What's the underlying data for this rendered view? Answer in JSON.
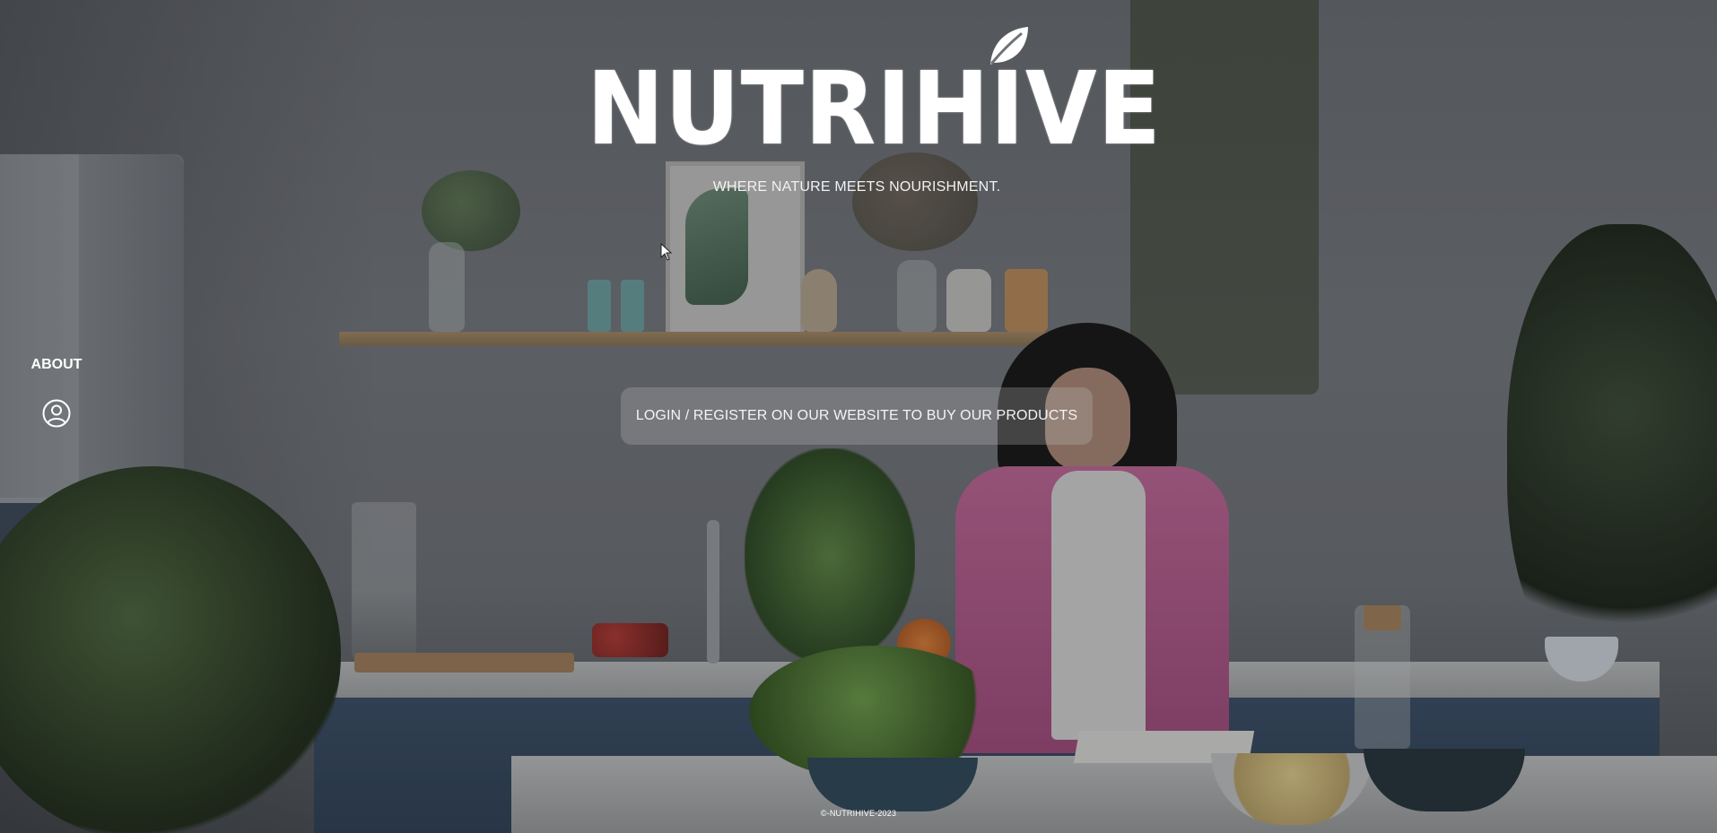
{
  "brand": {
    "title": "NUTRIHIVE",
    "tagline": "WHERE NATURE MEETS NOURISHMENT.",
    "logo_icon": "leaf-icon"
  },
  "side_nav": {
    "about_label": "ABOUT",
    "user_icon": "user-circle-icon"
  },
  "cta": {
    "login_register_text": "LOGIN / REGISTER ON OUR WEBSITE TO BUY OUR PRODUCTS"
  },
  "footer": {
    "copyright": "©-NUTRIHIVE-2023"
  },
  "colors": {
    "text": "#ffffff",
    "overlay": "#141618",
    "banner": "#bec0c2"
  }
}
